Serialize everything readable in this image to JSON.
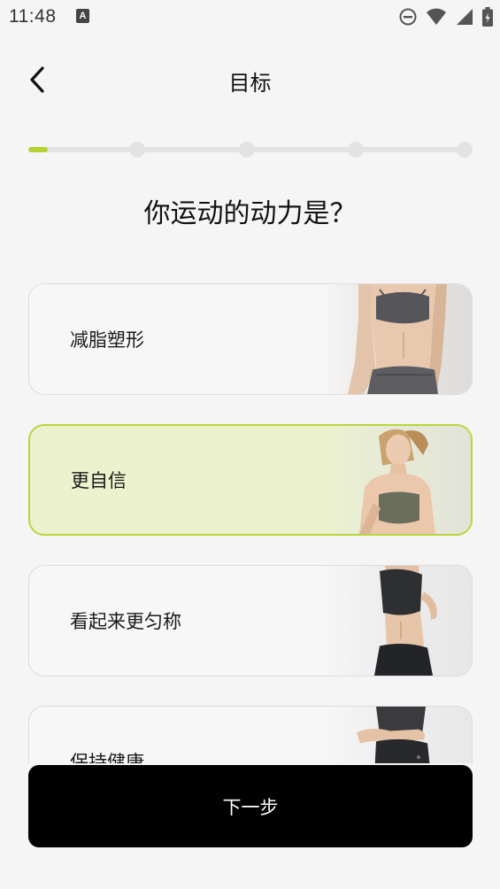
{
  "status_bar": {
    "time": "11:48",
    "notification_icon_letter": "A",
    "icons": [
      "a-notification-icon",
      "do-not-disturb-icon",
      "wifi-icon",
      "cellular-signal-icon",
      "battery-icon"
    ]
  },
  "header": {
    "back_icon": "chevron-left-icon",
    "title": "目标"
  },
  "progress": {
    "steps": 5,
    "current_step": 1,
    "accent_color": "#b5d233",
    "track_color": "#e3e3e3"
  },
  "question": "你运动的动力是？",
  "options": [
    {
      "label": "减脂塑形",
      "selected": false,
      "image": "fitness-woman-abs-photo"
    },
    {
      "label": "更自信",
      "selected": true,
      "image": "fitness-woman-portrait-photo"
    },
    {
      "label": "看起来更匀称",
      "selected": false,
      "image": "fitness-woman-waist-photo"
    },
    {
      "label": "保持健康",
      "selected": false,
      "image": "fitness-woman-back-photo"
    }
  ],
  "next_button": {
    "label": "下一步"
  },
  "colors": {
    "selected_background": "#ecf2cd",
    "selected_border": "#b8d63c",
    "button_background": "#000000"
  }
}
